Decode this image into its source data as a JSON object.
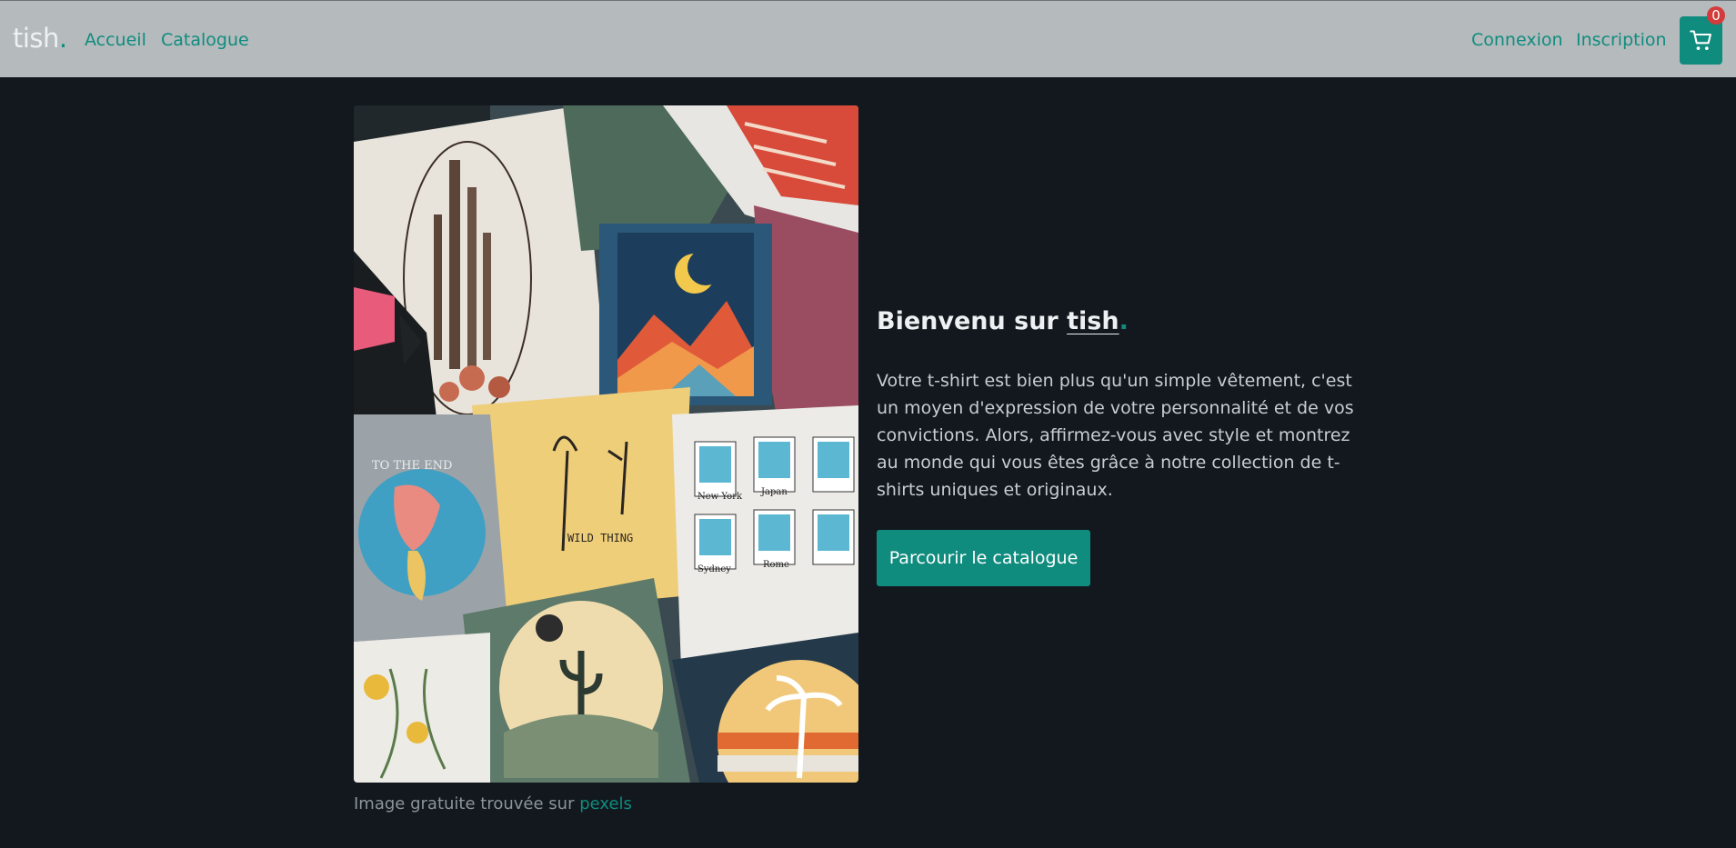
{
  "nav": {
    "brand": "tish",
    "brand_dot": ".",
    "links": [
      "Accueil",
      "Catalogue"
    ],
    "right_links": [
      "Connexion",
      "Inscription"
    ],
    "cart_count": "0",
    "cart_icon": "shopping-cart-icon"
  },
  "hero": {
    "title_prefix": "Bienvenu sur ",
    "title_brand": "tish",
    "title_dot": ".",
    "body": "Votre t-shirt est bien plus qu'un simple vêtement, c'est un moyen d'expression de votre personnalité et de vos convictions. Alors, affirmez-vous avec style et montrez au monde qui vous êtes grâce à notre collection de t-shirts uniques et originaux.",
    "cta_label": "Parcourir le catalogue"
  },
  "image": {
    "caption_prefix": "Image gratuite trouvée sur ",
    "caption_link": "pexels",
    "shirt_texts": [
      "WILD THING",
      "TO THE END",
      "New York",
      "Japan",
      "Sydney",
      "Rome"
    ]
  },
  "colors": {
    "accent": "#0f8c7e",
    "navbar_bg": "#b5babd",
    "page_bg": "#12181d",
    "badge": "#d43b3b"
  }
}
